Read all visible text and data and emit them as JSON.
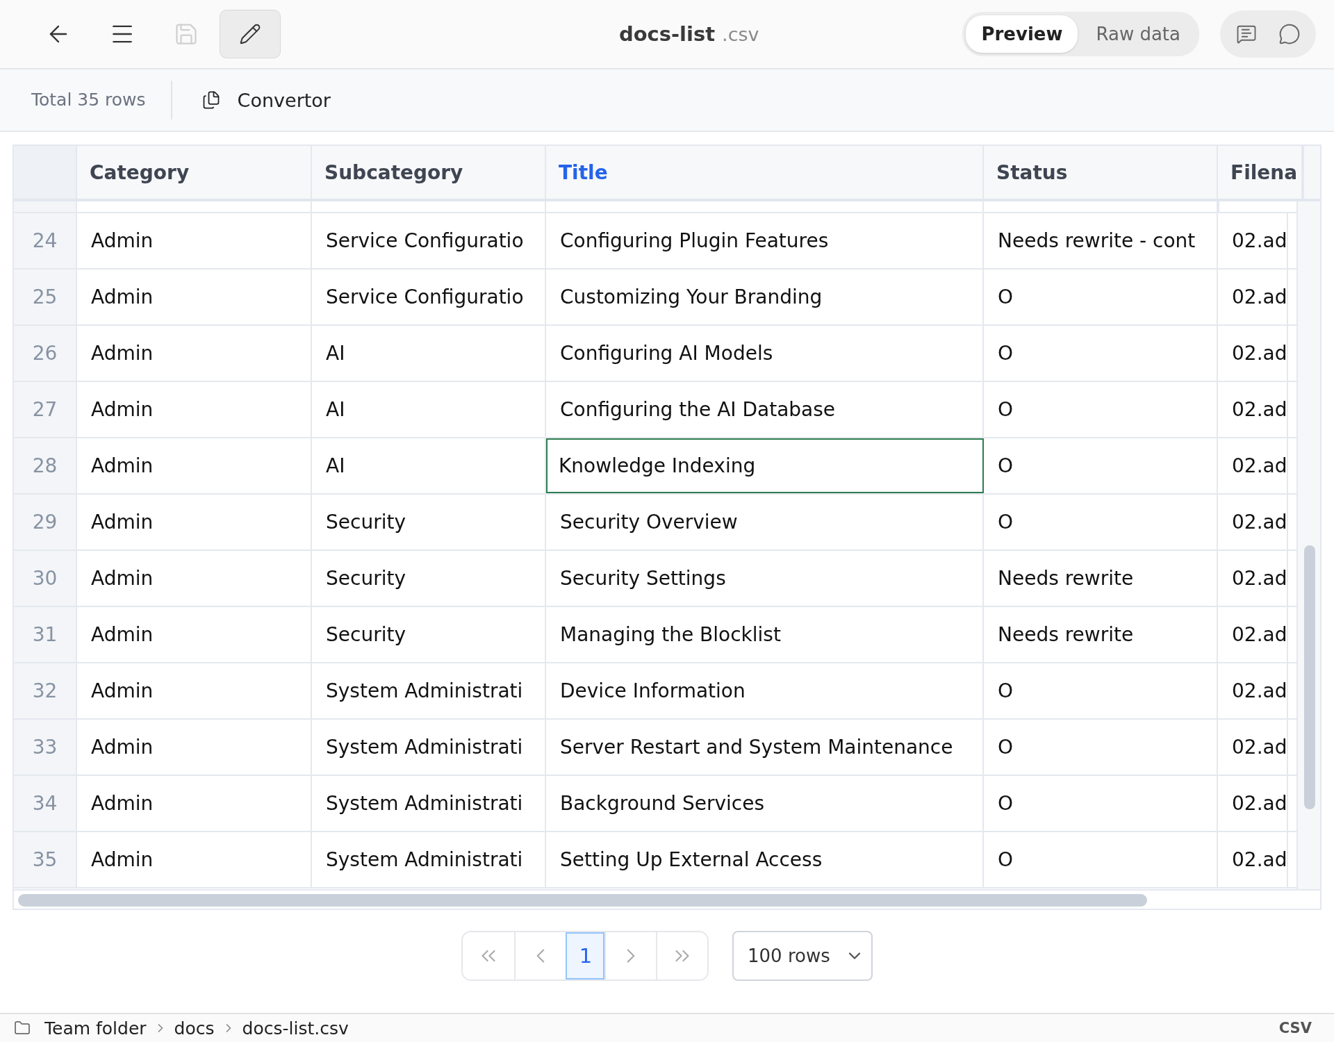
{
  "header": {
    "toolbar": [
      {
        "kind": "back",
        "disabled": false,
        "pressed": false
      },
      {
        "kind": "menu",
        "disabled": false,
        "pressed": false
      },
      {
        "kind": "save",
        "disabled": true,
        "pressed": false
      },
      {
        "kind": "edit",
        "disabled": false,
        "pressed": true
      }
    ],
    "file_name": "docs-list",
    "file_ext": ".csv",
    "tabs": [
      {
        "label": "Preview",
        "selected": true
      },
      {
        "label": "Raw data",
        "selected": false
      }
    ],
    "actions": [
      {
        "kind": "notes"
      },
      {
        "kind": "comment"
      }
    ]
  },
  "subbar": {
    "total": "Total 35 rows",
    "convertor": "Convertor"
  },
  "table": {
    "columns": [
      {
        "label": "Category",
        "selected": false
      },
      {
        "label": "Subcategory",
        "selected": false
      },
      {
        "label": "Title",
        "selected": true
      },
      {
        "label": "Status",
        "selected": false
      },
      {
        "label": "Filena",
        "selected": false
      }
    ],
    "rows": [
      {
        "num": "24",
        "cells": [
          "Admin",
          "Service Configuratio",
          "Configuring Plugin Features",
          "Needs rewrite - cont",
          "02.ad"
        ],
        "focused": false
      },
      {
        "num": "25",
        "cells": [
          "Admin",
          "Service Configuratio",
          "Customizing Your Branding",
          "O",
          "02.ad"
        ],
        "focused": false
      },
      {
        "num": "26",
        "cells": [
          "Admin",
          "AI",
          "Configuring AI Models",
          "O",
          "02.ad"
        ],
        "focused": false
      },
      {
        "num": "27",
        "cells": [
          "Admin",
          "AI",
          "Configuring the AI Database",
          "O",
          "02.ad"
        ],
        "focused": false
      },
      {
        "num": "28",
        "cells": [
          "Admin",
          "AI",
          "Knowledge Indexing",
          "O",
          "02.ad"
        ],
        "focused": true
      },
      {
        "num": "29",
        "cells": [
          "Admin",
          "Security",
          "Security Overview",
          "O",
          "02.ad"
        ],
        "focused": false
      },
      {
        "num": "30",
        "cells": [
          "Admin",
          "Security",
          "Security Settings",
          "Needs rewrite",
          "02.ad"
        ],
        "focused": false
      },
      {
        "num": "31",
        "cells": [
          "Admin",
          "Security",
          "Managing the Blocklist",
          "Needs rewrite",
          "02.ad"
        ],
        "focused": false
      },
      {
        "num": "32",
        "cells": [
          "Admin",
          "System Administrati",
          "Device Information",
          "O",
          "02.ad"
        ],
        "focused": false
      },
      {
        "num": "33",
        "cells": [
          "Admin",
          "System Administrati",
          "Server Restart and System Maintenance",
          "O",
          "02.ad"
        ],
        "focused": false
      },
      {
        "num": "34",
        "cells": [
          "Admin",
          "System Administrati",
          "Background Services",
          "O",
          "02.ad"
        ],
        "focused": false
      },
      {
        "num": "35",
        "cells": [
          "Admin",
          "System Administrati",
          "Setting Up External Access",
          "O",
          "02.ad"
        ],
        "focused": false
      }
    ]
  },
  "pagination": {
    "buttons": [
      {
        "kind": "first",
        "selected": false
      },
      {
        "kind": "prev",
        "selected": false
      },
      {
        "kind": "page",
        "label": "1",
        "selected": true
      },
      {
        "kind": "next",
        "selected": false
      },
      {
        "kind": "last",
        "selected": false
      }
    ],
    "page_size": "100 rows"
  },
  "footer": {
    "breadcrumbs": [
      "Team folder",
      "docs",
      "docs-list.csv"
    ],
    "type": "CSV"
  }
}
